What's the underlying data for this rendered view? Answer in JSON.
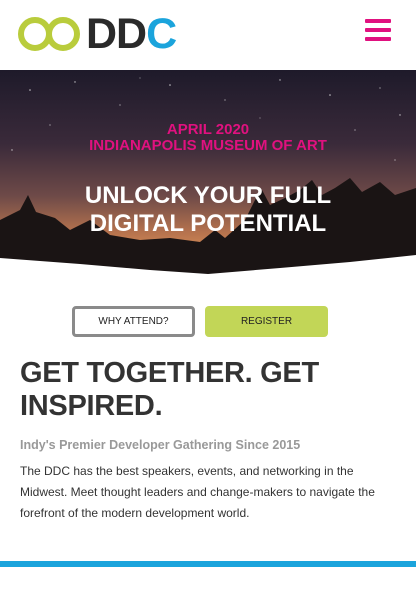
{
  "header": {
    "logo_text_dd": "DD",
    "logo_text_c": "C",
    "logo_ring_color": "#b9cc3c",
    "menu_icon": "hamburger-menu-icon",
    "menu_color": "#e0117f"
  },
  "hero": {
    "date": "APRIL 2020",
    "venue": "INDIANAPOLIS MUSEUM OF ART",
    "title": "UNLOCK YOUR FULL DIGITAL POTENTIAL",
    "accent_color": "#e0117f"
  },
  "actions": {
    "why_attend_label": "WHY ATTEND?",
    "register_label": "REGISTER",
    "register_color": "#c2d657"
  },
  "content": {
    "heading": "GET TOGETHER. GET INSPIRED.",
    "subheading": "Indy's Premier Developer Gathering Since 2015",
    "body": "The DDC has the best speakers, events, and networking in the Midwest. Meet thought leaders and change-makers to navigate the forefront of the modern development world."
  },
  "colors": {
    "brand_blue": "#1ba4dc",
    "text_dark": "#333333",
    "text_muted": "#999999"
  }
}
